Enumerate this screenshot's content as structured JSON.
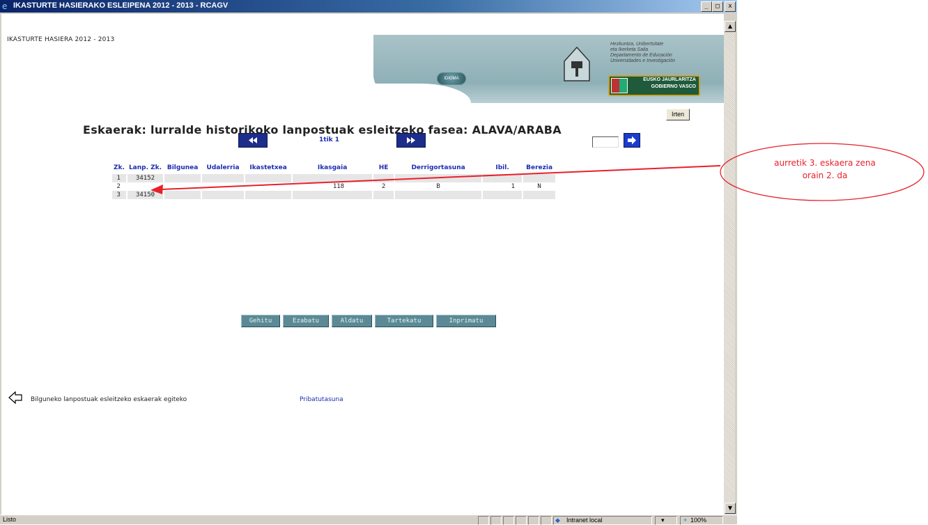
{
  "window": {
    "title": "IKASTURTE HASIERAKO ESLEIPENA 2012 - 2013 - RCAGV",
    "minimize": "_",
    "maximize": "□",
    "close": "x"
  },
  "header": {
    "label": "IKASTURTE HASIERA 2012 - 2013",
    "idioma": "IDIOMA",
    "gov_lines": [
      "Hezkuntza, Unibertsitate",
      "eta Ikerketa Saila",
      "Departamento de Educación",
      "Universidades e Investigación"
    ],
    "gov_badge": [
      "EUSKO JAURLARITZA",
      "GOBIERNO VASCO"
    ]
  },
  "irten_label": "Irten",
  "page_title": "Eskaerak: lurralde historikoko lanpostuak esleitzeko fasea: ALAVA/ARABA",
  "pager": {
    "text": "1tik 1"
  },
  "table": {
    "headers": [
      "Zk.",
      "Lanp. Zk.",
      "Bilgunea",
      "Udalerria",
      "Ikastetxea",
      "Ikasgaia",
      "HE",
      "Derrigortasuna",
      "Ibil.",
      "Berezia"
    ],
    "rows": [
      [
        "1",
        "34152",
        "",
        "",
        "",
        "",
        "",
        "",
        "",
        ""
      ],
      [
        "2",
        "",
        "",
        "",
        "",
        "118",
        "2",
        "B",
        "1",
        "N"
      ],
      [
        "3",
        "34150",
        "",
        "",
        "",
        "",
        "",
        "",
        "",
        ""
      ]
    ]
  },
  "actions": [
    "Gehitu",
    "Ezabatu",
    "Aldatu",
    "Tartekatu",
    "Inprimatu"
  ],
  "footer": {
    "back_link": "Bilguneko lanpostuak esleitzeko eskaerak egiteko",
    "privacy": "Pribatutasuna"
  },
  "status": {
    "left": "Listo",
    "zone": "Intranet local",
    "zoom": "100%"
  },
  "annotation": {
    "line1": "aurretik 3. eskaera zena",
    "line2": "orain 2. da"
  }
}
